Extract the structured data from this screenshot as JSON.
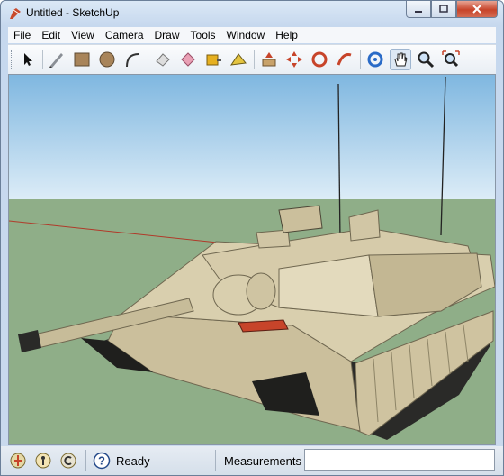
{
  "window": {
    "title": "Untitled - SketchUp"
  },
  "menu": [
    "File",
    "Edit",
    "View",
    "Camera",
    "Draw",
    "Tools",
    "Window",
    "Help"
  ],
  "toolbar": {
    "tools": [
      "select-icon",
      "pencil-icon",
      "rectangle-icon",
      "circle-icon",
      "arc-icon",
      "eraser-icon",
      "paint-bucket-icon",
      "tape-measure-icon",
      "push-pull-icon",
      "follow-me-icon",
      "move-icon",
      "rotate-icon",
      "offset-icon",
      "orbit-icon",
      "pan-icon",
      "zoom-icon",
      "zoom-extents-icon"
    ],
    "active_tool": "pan-icon"
  },
  "status": {
    "text": "Ready",
    "measurements_label": "Measurements",
    "measurements_value": ""
  },
  "colors": {
    "sky_top": "#7fb7e0",
    "sky_bottom": "#dcecf7",
    "ground": "#8fae88",
    "model": "#d6cbaa",
    "accent": "#c7442a"
  }
}
